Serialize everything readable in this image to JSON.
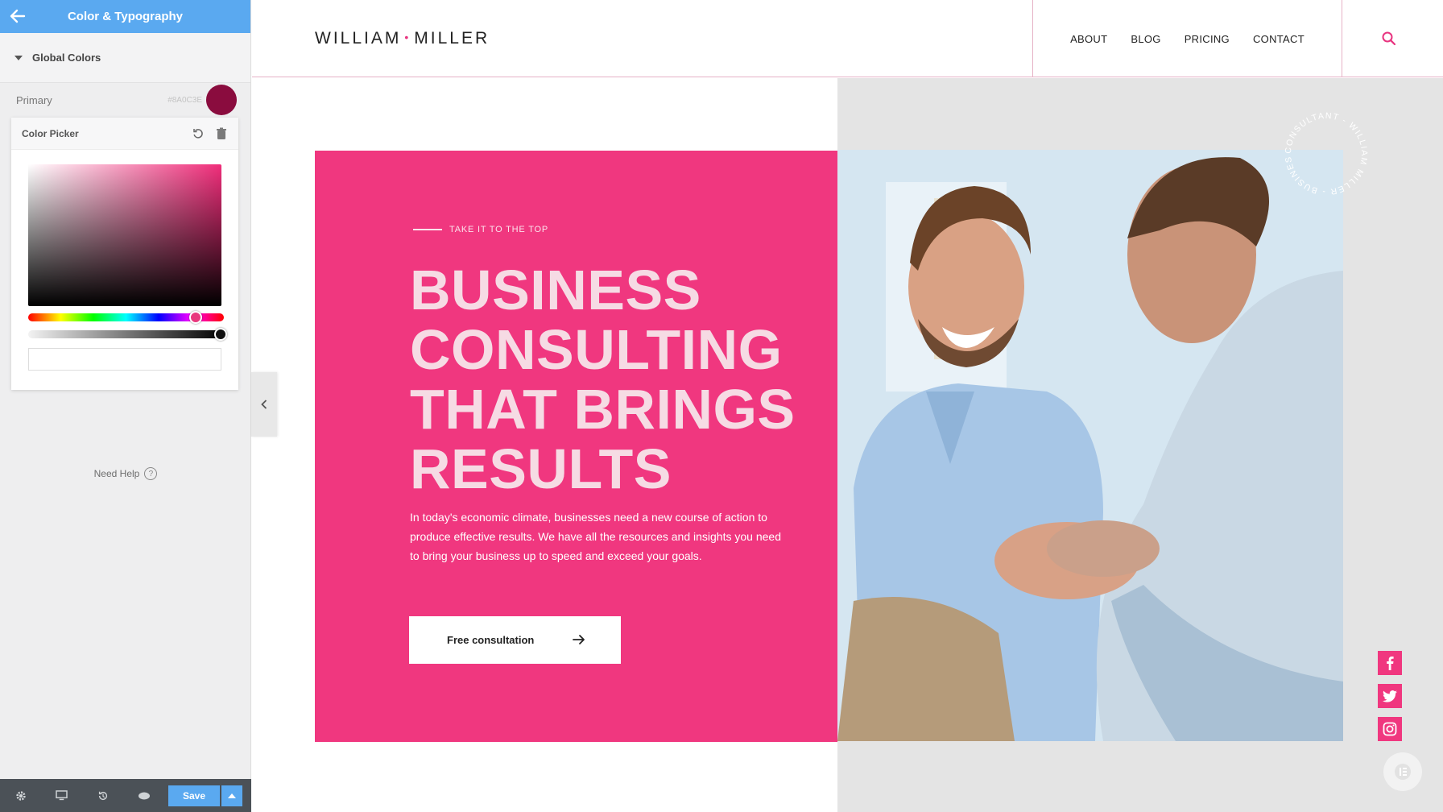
{
  "panel": {
    "title": "Color & Typography",
    "section_label": "Global Colors",
    "primary_label": "Primary",
    "primary_hex": "#8A0C3E",
    "picker_label": "Color Picker",
    "hex_input_value": "",
    "hue_value": 0.94,
    "alpha_value": 1.0,
    "need_help": "Need Help",
    "save_label": "Save",
    "accent_color": "#5aa9f0",
    "icons": [
      "back-arrow-icon",
      "reset-icon",
      "trash-icon",
      "gear-icon",
      "desktop-icon",
      "history-icon",
      "eye-icon",
      "chevron-up-icon",
      "chevron-left-icon",
      "help-icon"
    ]
  },
  "site": {
    "logo_left": "WILLIAM",
    "logo_dot": "•",
    "logo_right": "MILLER",
    "nav": [
      "ABOUT",
      "BLOG",
      "PRICING",
      "CONTACT"
    ],
    "eyebrow": "TAKE IT TO THE TOP",
    "headline": [
      "BUSINESS",
      "CONSULTING",
      "THAT BRINGS",
      "RESULTS"
    ],
    "body": "In today's economic climate, businesses need a new course of action to produce effective results. We have all the resources and insights you need to bring your business up to speed and exceed your goals.",
    "cta_label": "Free consultation",
    "badge_text": "CONSULTANT - WILLIAM MILLER - BUSINESS ",
    "brand_color": "#f0377f",
    "socials": [
      "facebook-icon",
      "twitter-icon",
      "instagram-icon"
    ]
  }
}
